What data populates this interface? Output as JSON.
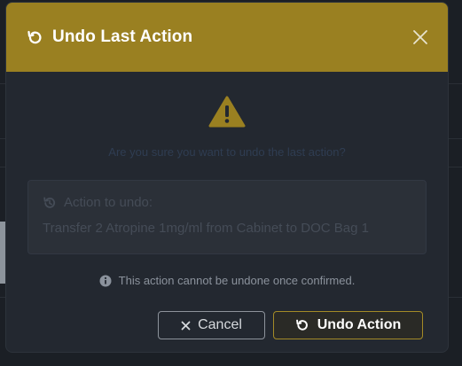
{
  "dialog": {
    "title": "Undo Last Action",
    "header_color": "#9a8021",
    "icon": "undo-icon",
    "close_icon": "close-icon"
  },
  "content": {
    "warning_icon": "warning-triangle-icon",
    "warning_color": "#9a8021",
    "message": "Are you sure you want to undo the last action?",
    "action_label": "Action to undo:",
    "action_label_icon": "history-icon",
    "action_description": "Transfer 2 Atropine 1mg/ml from Cabinet to DOC Bag 1",
    "note_icon": "info-circle-icon",
    "note": "This action cannot be undone once confirmed."
  },
  "footer": {
    "cancel_label": "Cancel",
    "cancel_icon": "times-icon",
    "confirm_label": "Undo Action",
    "confirm_icon": "undo-icon"
  }
}
